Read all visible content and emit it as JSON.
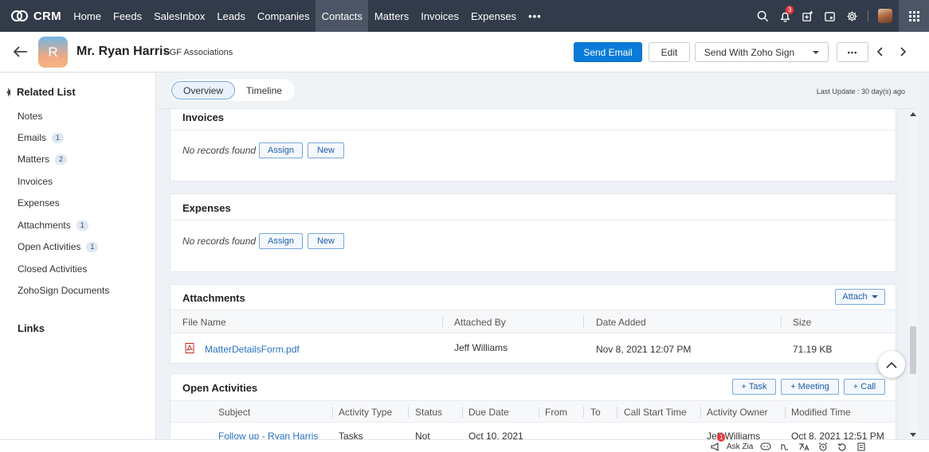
{
  "nav": {
    "brand": "CRM",
    "tabs": [
      "Home",
      "Feeds",
      "SalesInbox",
      "Leads",
      "Companies",
      "Contacts",
      "Matters",
      "Invoices",
      "Expenses",
      "•••"
    ],
    "active_tab": "Contacts",
    "notification_count": "3"
  },
  "header": {
    "avatar_initial": "R",
    "name": "Mr. Ryan Harris",
    "company": "- GF Associations",
    "send_email": "Send Email",
    "edit": "Edit",
    "send_zoho_sign": "Send With Zoho Sign",
    "more": "•••"
  },
  "sidebar": {
    "title": "Related List",
    "items": [
      {
        "label": "Notes",
        "count": ""
      },
      {
        "label": "Emails",
        "count": "1"
      },
      {
        "label": "Matters",
        "count": "2"
      },
      {
        "label": "Invoices",
        "count": ""
      },
      {
        "label": "Expenses",
        "count": ""
      },
      {
        "label": "Attachments",
        "count": "1"
      },
      {
        "label": "Open Activities",
        "count": "1"
      },
      {
        "label": "Closed Activities",
        "count": ""
      },
      {
        "label": "ZohoSign Documents",
        "count": ""
      }
    ],
    "links_title": "Links"
  },
  "tabs": {
    "overview": "Overview",
    "timeline": "Timeline",
    "last_update": "Last Update : 30 day(s) ago"
  },
  "invoices": {
    "title": "Invoices",
    "empty": "No records found",
    "assign": "Assign",
    "new": "New"
  },
  "expenses": {
    "title": "Expenses",
    "empty": "No records found",
    "assign": "Assign",
    "new": "New"
  },
  "attachments": {
    "title": "Attachments",
    "attach": "Attach",
    "columns": [
      "File Name",
      "Attached By",
      "Date Added",
      "Size"
    ],
    "rows": [
      {
        "file_name": "MatterDetailsForm.pdf",
        "attached_by": "Jeff Williams",
        "date_added": "Nov 8, 2021 12:07 PM",
        "size": "71.19 KB"
      }
    ]
  },
  "open_activities": {
    "title": "Open Activities",
    "task": "+ Task",
    "meeting": "+ Meeting",
    "call": "+ Call",
    "columns": [
      "Subject",
      "Activity Type",
      "Status",
      "Due Date",
      "From",
      "To",
      "Call Start Time",
      "Activity Owner",
      "Modified Time"
    ],
    "rows": [
      {
        "subject": "Follow up - Ryan Harris",
        "activity_type": "Tasks",
        "status": "Not",
        "due_date": "Oct 10, 2021",
        "from": "",
        "to": "",
        "call_start": "",
        "owner": "Jeff Williams",
        "modified": "Oct 8, 2021 12:51 PM"
      }
    ]
  },
  "bottom": {
    "ask_zia": "Ask Zia",
    "badge": "1"
  },
  "colors": {
    "nav_bg": "#323b49",
    "primary": "#0a7bd8",
    "link": "#2a72c2",
    "badge": "#e6373e"
  }
}
